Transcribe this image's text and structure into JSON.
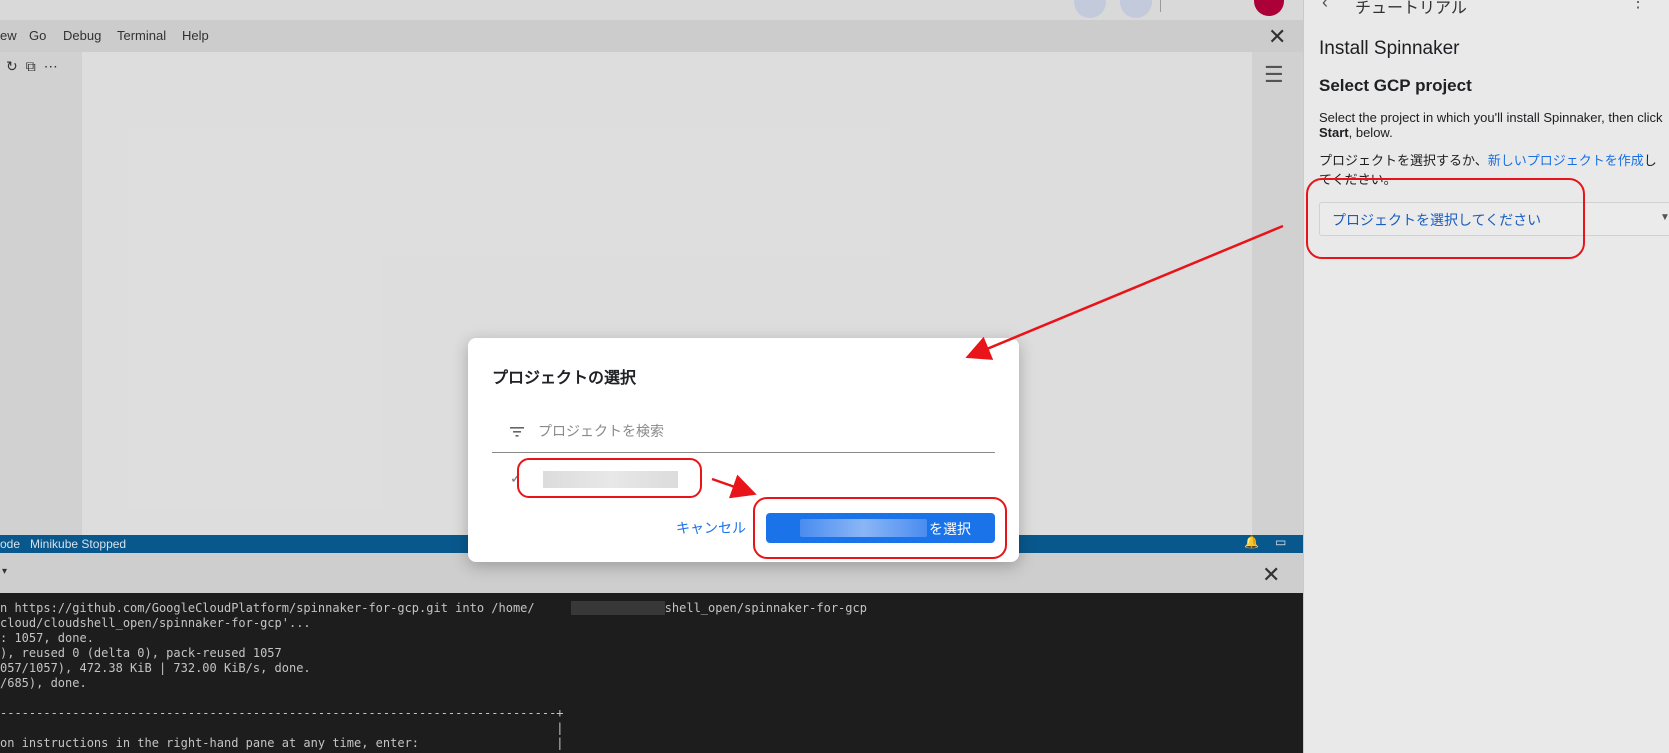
{
  "menubar": {
    "items": [
      "ew",
      "Go",
      "Debug",
      "Terminal",
      "Help"
    ]
  },
  "statusbar": {
    "left_text": "ode   Minikube Stopped"
  },
  "terminal": {
    "lines": [
      "n https://github.com/GoogleCloudPlatform/spinnaker-for-gcp.git into /home/            /cloudshell_open/spinnaker-for-gcp",
      "cloud/cloudshell_open/spinnaker-for-gcp'...",
      ": 1057, done.",
      "), reused 0 (delta 0), pack-reused 1057",
      "057/1057), 472.38 KiB | 732.00 KiB/s, done.",
      "/685), done.",
      "",
      "-----------------------------------------------------------------------------+",
      "                                                                             |",
      "on instructions in the right-hand pane at any time, enter:                   |"
    ]
  },
  "tutorial": {
    "header_title": "チュートリアル",
    "title": "Install Spinnaker",
    "subtitle": "Select GCP project",
    "desc_before": "Select the project in which you'll install Spinnaker, then click ",
    "desc_bold": "Start",
    "desc_after": ", below.",
    "jp_before": "プロジェクトを選択するか、",
    "jp_link": "新しいプロジェクトを作成",
    "jp_after": "してください。",
    "select_label": "プロジェクトを選択してください"
  },
  "dialog": {
    "title": "プロジェクトの選択",
    "search_placeholder": "プロジェクトを検索",
    "check_mark": "✓",
    "cancel_label": "キャンセル",
    "select_suffix": "を選択"
  },
  "colors": {
    "accent": "#1a73e8",
    "annotation": "#e8141a",
    "statusbar": "#0a5a90"
  },
  "icons": {
    "editor_close": "close-icon",
    "outline": "list-icon",
    "filter": "filter-icon",
    "check": "check-icon"
  }
}
